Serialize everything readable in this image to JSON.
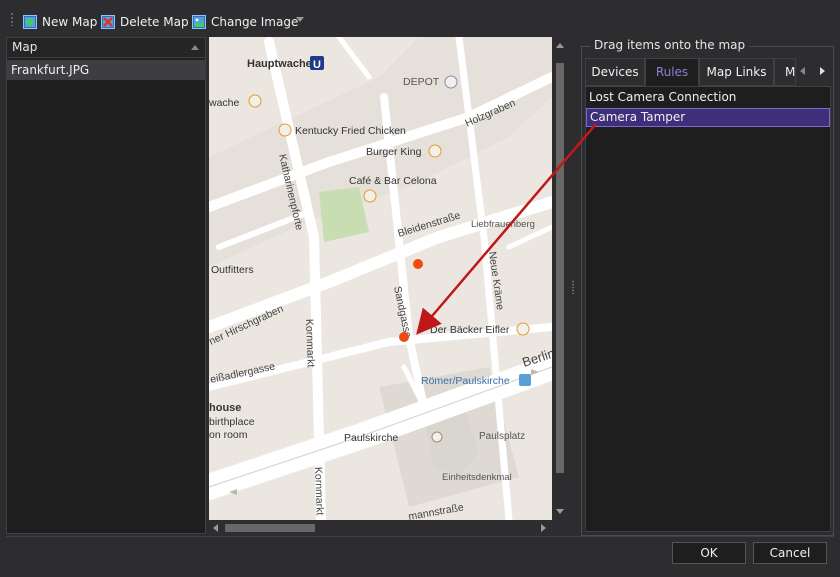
{
  "toolbar": {
    "new_map_label": "New Map",
    "delete_map_label": "Delete Map",
    "change_image_label": "Change Image",
    "icons": [
      "map-add-icon",
      "map-delete-icon",
      "map-image-icon",
      "dropdown-icon"
    ]
  },
  "map_list": {
    "header": "Map",
    "items": [
      "Frankfurt.JPG"
    ]
  },
  "map": {
    "labels": {
      "hauptwache": "Hauptwache",
      "ubahn": "U",
      "depot": "DEPOT",
      "holzgraben": "Holzgraben",
      "wache": "wache",
      "kfc": "Kentucky Fried Chicken",
      "burger_king": "Burger King",
      "cafe": "Café & Bar Celona",
      "katharinenpforte": "Katharinenpforte",
      "bleidenstrasse": "Bleidenstraße",
      "liebfrauenberg": "Liebfrauenberg",
      "outfitters": "Outfitters",
      "neue_kraeme": "Neue Kräme",
      "hirschgraben": "ner Hirschgraben",
      "sandgasse": "Sandgasse",
      "kornmarkt": "Kornmarkt",
      "baecker": "Der Bäcker Eifler",
      "berlin": "Berlin",
      "adlergasse": "eißadlergasse",
      "roemer": "Römer/Paulskirche",
      "house": "house",
      "birthplace": "birthplace",
      "on_room": "on room",
      "paulskirche": "Paulskirche",
      "paulsplatz": "Paulsplatz",
      "kornmarkt2": "Kornmarkt",
      "einheitsdenkmal": "Einheitsdenkmal",
      "mannstrasse": "mannstraße"
    },
    "camera_marker_color": "#f04a12"
  },
  "right_panel": {
    "group_title": "Drag items onto the map",
    "tabs": [
      "Devices",
      "Rules",
      "Map Links",
      "M"
    ],
    "active_tab": "Rules",
    "items": [
      "Lost Camera Connection",
      "Camera Tamper"
    ],
    "selected_item": "Camera Tamper"
  },
  "buttons": {
    "ok": "OK",
    "cancel": "Cancel"
  },
  "colors": {
    "accent": "#8d7fd6",
    "selection": "#3f2f7a",
    "drag_arrow": "#c01818"
  }
}
